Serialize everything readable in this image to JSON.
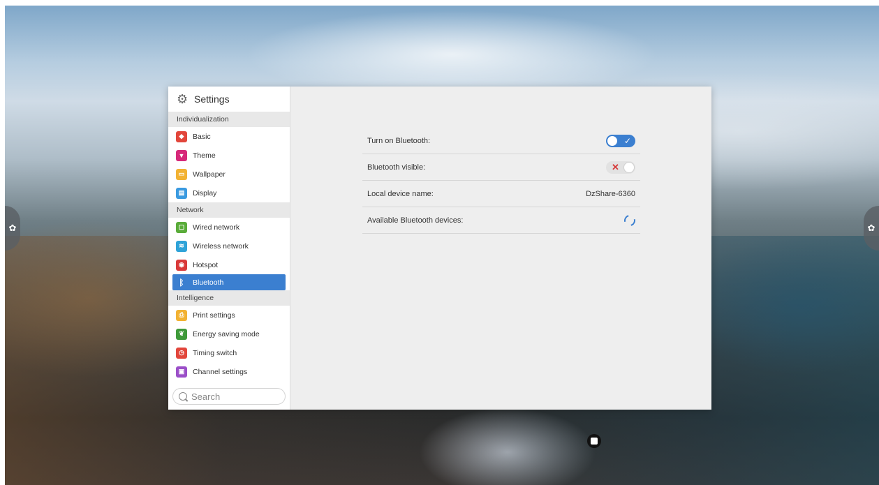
{
  "window": {
    "title": "Settings",
    "title_icon": "gear-icon"
  },
  "sidebar": {
    "sections": [
      {
        "label": "Individualization",
        "items": [
          {
            "label": "Basic",
            "icon": "basic-icon",
            "color": "#e2463b"
          },
          {
            "label": "Theme",
            "icon": "theme-shirt-icon",
            "color": "#d6297a"
          },
          {
            "label": "Wallpaper",
            "icon": "wallpaper-icon",
            "color": "#f2b233"
          },
          {
            "label": "Display",
            "icon": "display-icon",
            "color": "#3a9ae0"
          }
        ]
      },
      {
        "label": "Network",
        "items": [
          {
            "label": "Wired network",
            "icon": "wired-network-icon",
            "color": "#5aac3a"
          },
          {
            "label": "Wireless network",
            "icon": "wifi-icon",
            "color": "#2fa3d8"
          },
          {
            "label": "Hotspot",
            "icon": "hotspot-icon",
            "color": "#d93a3a"
          },
          {
            "label": "Bluetooth",
            "icon": "bluetooth-icon",
            "color": "#3b7fd0",
            "active": true
          }
        ]
      },
      {
        "label": "Intelligence",
        "items": [
          {
            "label": "Print settings",
            "icon": "print-icon",
            "color": "#f2b233"
          },
          {
            "label": "Energy saving mode",
            "icon": "leaf-icon",
            "color": "#3f9a3a"
          },
          {
            "label": "Timing switch",
            "icon": "clock-icon",
            "color": "#e2463b"
          },
          {
            "label": "Channel settings",
            "icon": "channel-icon",
            "color": "#9b4fc8"
          }
        ]
      }
    ],
    "search_placeholder": "Search"
  },
  "bluetooth": {
    "turn_on_label": "Turn on Bluetooth:",
    "turn_on_state": true,
    "visible_label": "Bluetooth visible:",
    "visible_state": false,
    "device_name_label": "Local device name:",
    "device_name_value": "DzShare-6360",
    "available_label": "Available Bluetooth devices:"
  }
}
